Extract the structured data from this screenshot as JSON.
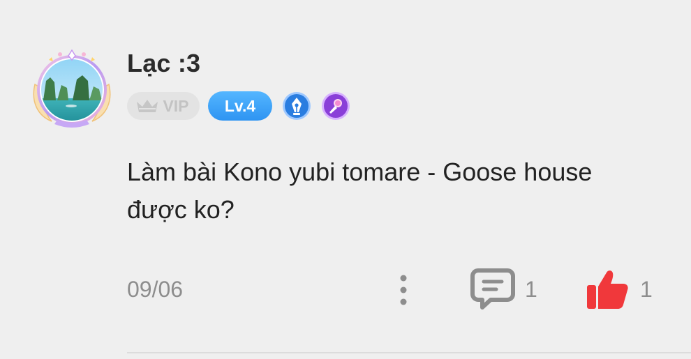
{
  "user": {
    "name": "Lạc :3",
    "vip_label": "VIP",
    "level_label": "Lv.4"
  },
  "comment": {
    "text": "Làm bài Kono yubi tomare - Goose house được ko?",
    "date": "09/06"
  },
  "actions": {
    "reply_count": "1",
    "like_count": "1"
  },
  "icons": {
    "avatar": "avatar-halong-bay-frame",
    "vip": "crown-icon",
    "badge_1": "pen-nib-icon",
    "badge_2": "microphone-icon",
    "more": "more-vertical-icon",
    "reply": "comment-bubble-icon",
    "like": "thumbs-up-icon"
  },
  "colors": {
    "level_badge": "#3aa2f7",
    "like": "#f0383b",
    "muted_text": "#8d8d8d",
    "pen_badge": "#2a7de0",
    "mic_badge": "#8a3fd8"
  }
}
